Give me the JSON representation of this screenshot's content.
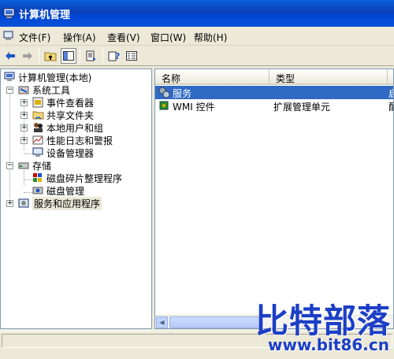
{
  "window": {
    "title": "计算机管理"
  },
  "menu": [
    {
      "label": "文件(F)"
    },
    {
      "label": "操作(A)"
    },
    {
      "label": "查看(V)"
    },
    {
      "label": "窗口(W)"
    },
    {
      "label": "帮助(H)"
    }
  ],
  "tree": {
    "root": "计算机管理(本地)",
    "system_tools": "系统工具",
    "event_viewer": "事件查看器",
    "shared_folders": "共享文件夹",
    "local_users": "本地用户和组",
    "perf_logs": "性能日志和警报",
    "device_manager": "设备管理器",
    "storage": "存储",
    "defrag": "磁盘碎片整理程序",
    "disk_mgmt": "磁盘管理",
    "services_apps": "服务和应用程序"
  },
  "list": {
    "columns": [
      "名称",
      "类型",
      "描"
    ],
    "rows": [
      {
        "name": "服务",
        "type": "",
        "desc": "启"
      },
      {
        "name": "WMI 控件",
        "type": "扩展管理单元",
        "desc": "配"
      }
    ]
  },
  "watermark": {
    "title": "比特部落",
    "url": "www.bit86.cn"
  },
  "colors": {
    "title_bar": "#0a52d8",
    "selection": "#316ac5",
    "watermark": "#1c3fc6"
  }
}
